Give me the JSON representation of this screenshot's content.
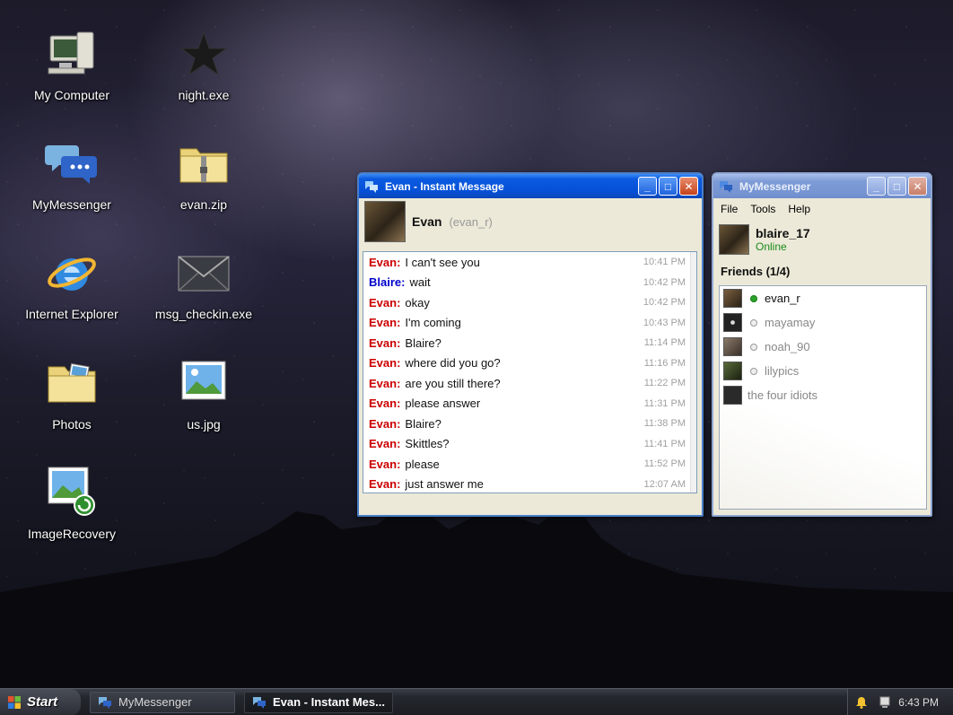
{
  "desktop": {
    "icons": [
      {
        "name": "mycomputer",
        "label": "My Computer"
      },
      {
        "name": "night",
        "label": "night.exe"
      },
      {
        "name": "mymessenger",
        "label": "MyMessenger"
      },
      {
        "name": "evanzip",
        "label": "evan.zip"
      },
      {
        "name": "ie",
        "label": "Internet Explorer"
      },
      {
        "name": "msg",
        "label": "msg_checkin.exe"
      },
      {
        "name": "photos",
        "label": "Photos"
      },
      {
        "name": "usjpg",
        "label": "us.jpg"
      },
      {
        "name": "imagerecovery",
        "label": "ImageRecovery"
      }
    ]
  },
  "im_window": {
    "title": "Evan - Instant Message",
    "contact_name": "Evan",
    "contact_handle": "(evan_r)",
    "messages": [
      {
        "sender": "Evan:",
        "text": "I can't see you",
        "time": "10:41 PM"
      },
      {
        "sender": "Blaire:",
        "text": "wait",
        "time": "10:42 PM"
      },
      {
        "sender": "Evan:",
        "text": "okay",
        "time": "10:42 PM"
      },
      {
        "sender": "Evan:",
        "text": "I'm coming",
        "time": "10:43 PM"
      },
      {
        "sender": "Evan:",
        "text": "Blaire?",
        "time": "11:14 PM"
      },
      {
        "sender": "Evan:",
        "text": "where did you go?",
        "time": "11:16 PM"
      },
      {
        "sender": "Evan:",
        "text": "are you still there?",
        "time": "11:22 PM"
      },
      {
        "sender": "Evan:",
        "text": "please answer",
        "time": "11:31 PM"
      },
      {
        "sender": "Evan:",
        "text": "Blaire?",
        "time": "11:38 PM"
      },
      {
        "sender": "Evan:",
        "text": "Skittles?",
        "time": "11:41 PM"
      },
      {
        "sender": "Evan:",
        "text": "please",
        "time": "11:52 PM"
      },
      {
        "sender": "Evan:",
        "text": "just answer me",
        "time": "12:07 AM"
      }
    ]
  },
  "messenger": {
    "title": "MyMessenger",
    "menu": {
      "file": "File",
      "tools": "Tools",
      "help": "Help"
    },
    "user": {
      "name": "blaire_17",
      "status": "Online"
    },
    "friends_header": "Friends (1/4)",
    "friends": [
      {
        "name": "evan_r",
        "online": true
      },
      {
        "name": "mayamay",
        "online": false
      },
      {
        "name": "noah_90",
        "online": false
      },
      {
        "name": "lilypics",
        "online": false
      },
      {
        "name": "the four idiots",
        "group": true
      }
    ]
  },
  "taskbar": {
    "start_label": "Start",
    "tasks": [
      {
        "label": "MyMessenger"
      },
      {
        "label": "Evan - Instant Mes..."
      }
    ],
    "clock": "6:43 PM"
  },
  "colors": {
    "titlebar_active": "#0550d8",
    "evan_name": "#cc0000",
    "blaire_name": "#0000cc",
    "online": "#27a327"
  }
}
